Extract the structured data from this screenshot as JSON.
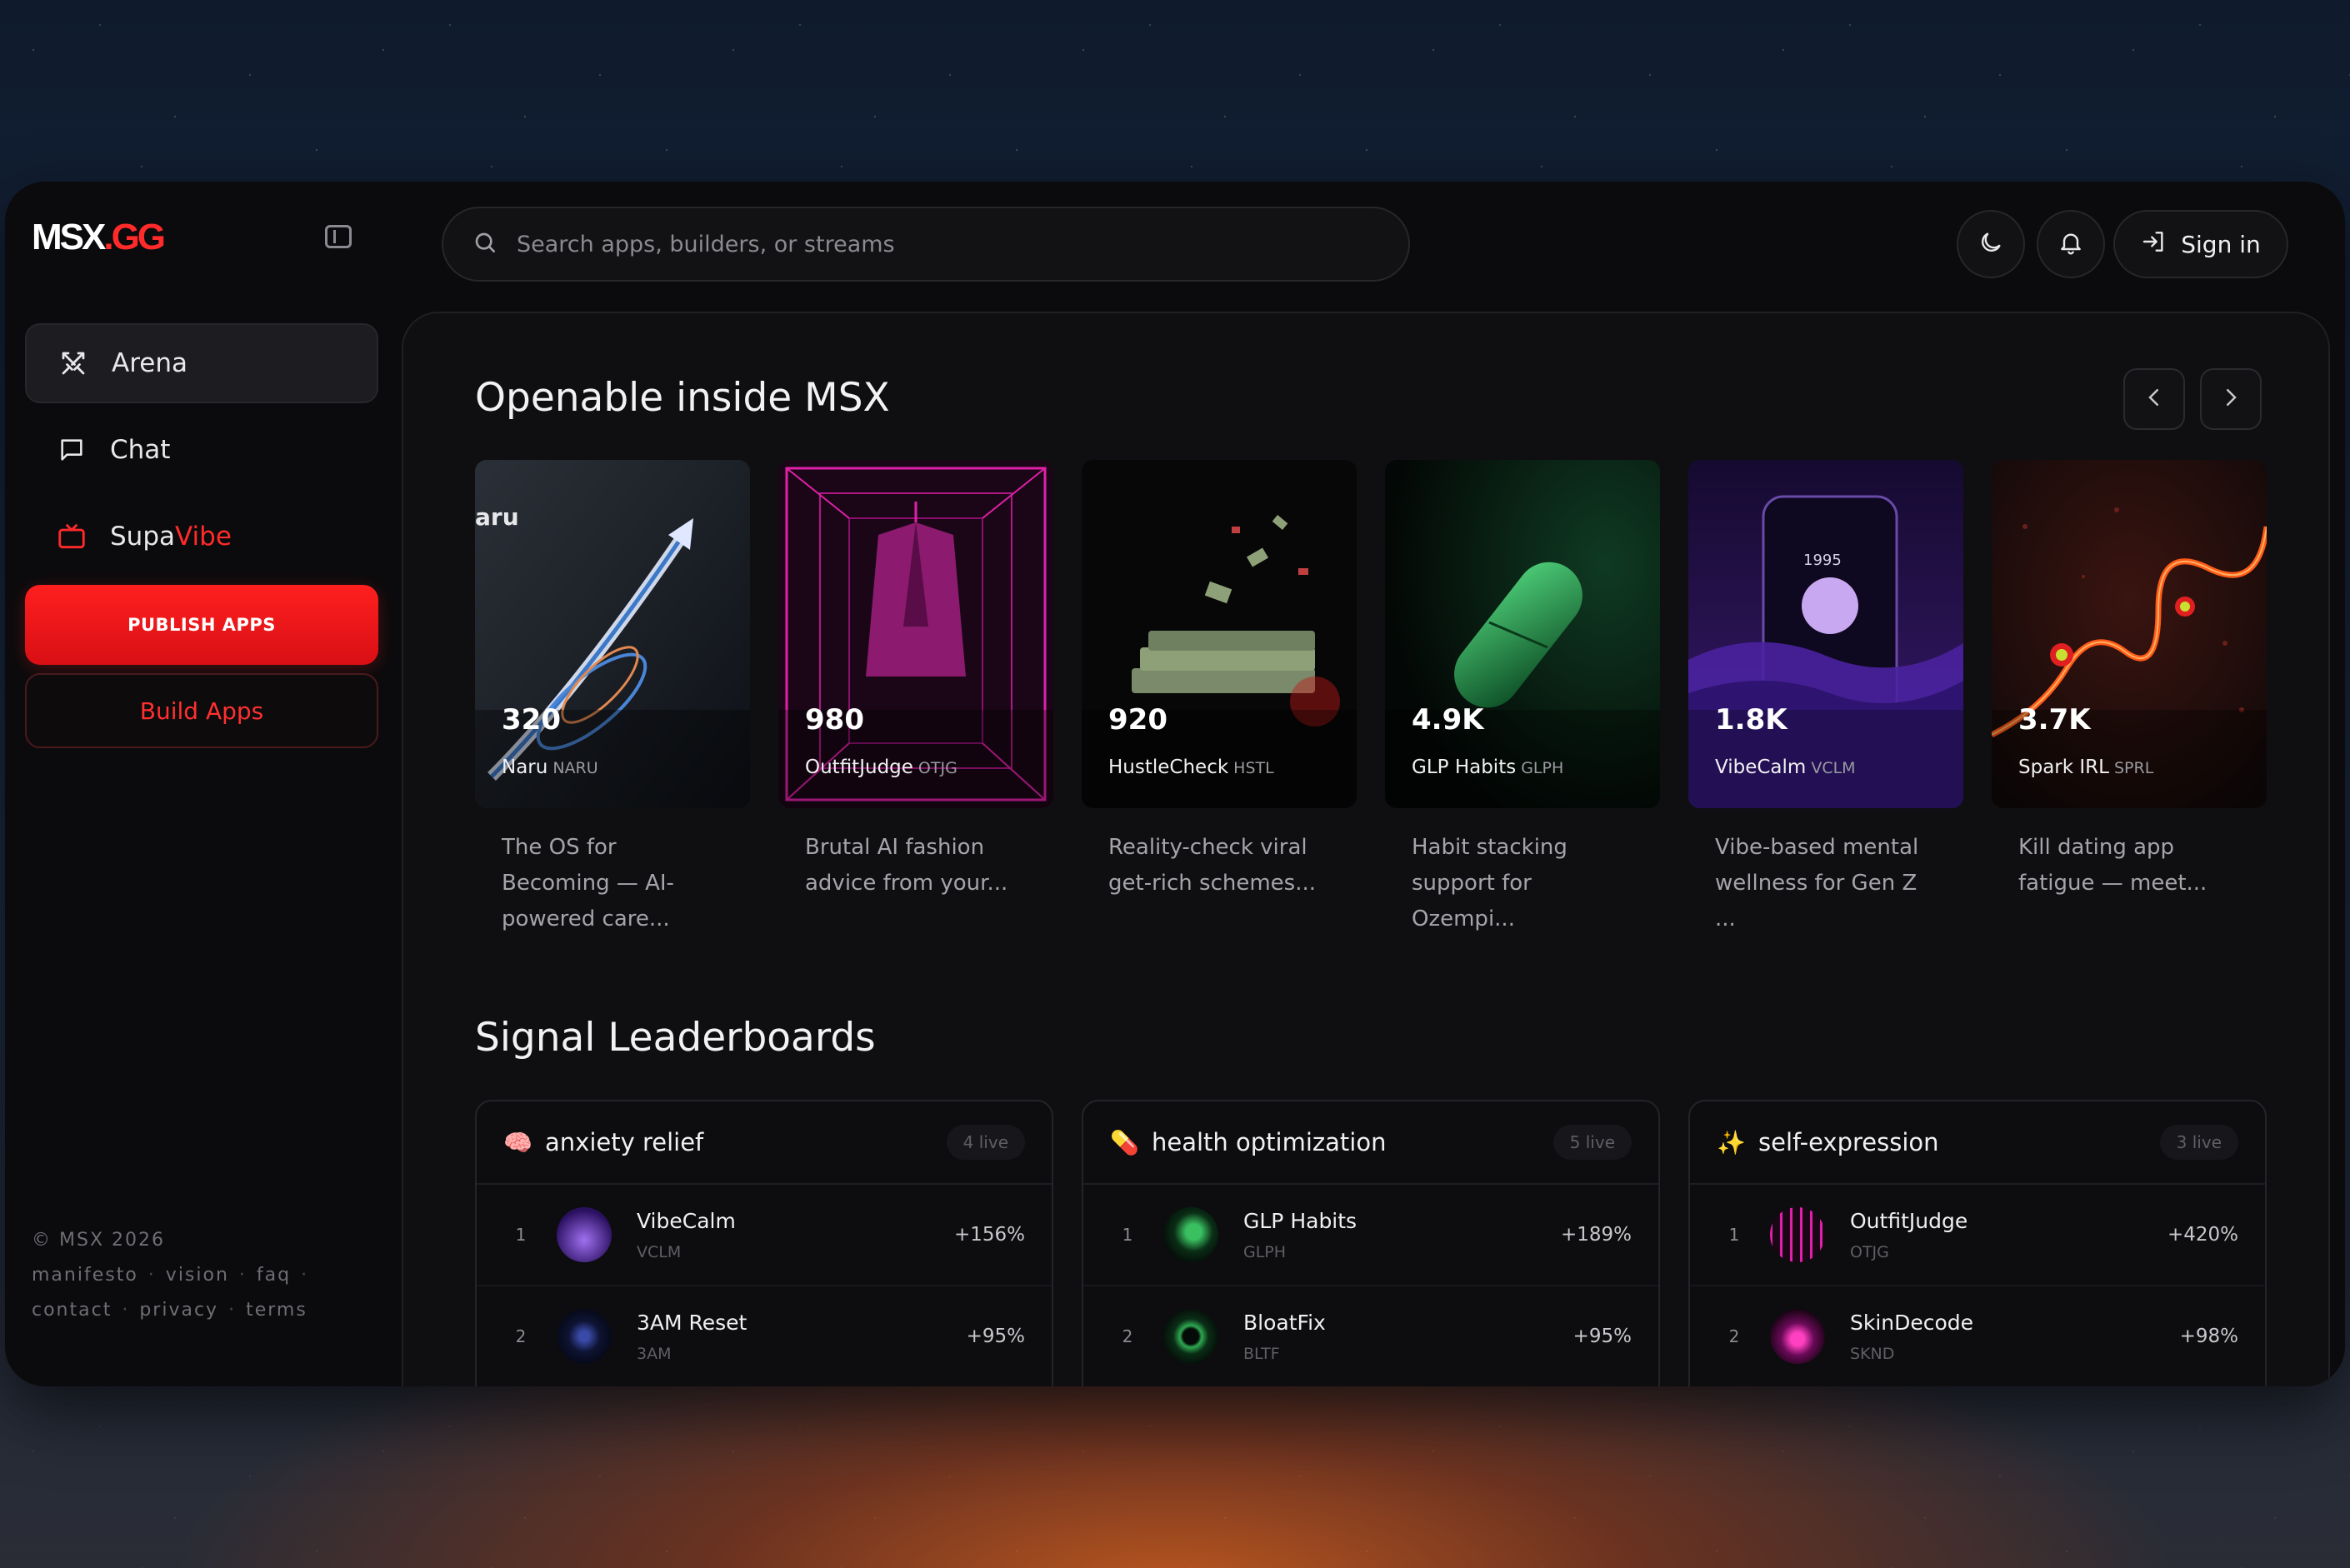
{
  "brand": {
    "logo_main": "MSX",
    "logo_dot": ".GG"
  },
  "sidebar": {
    "items": [
      {
        "label": "Arena",
        "icon": "crossed-swords-icon",
        "active": true
      },
      {
        "label": "Chat",
        "icon": "chat-bubble-icon"
      },
      {
        "label_a": "Supa",
        "label_b": "Vibe",
        "icon": "tv-icon"
      }
    ],
    "publish_label": "PUBLISH APPS",
    "build_label": "Build Apps",
    "footer": {
      "copyright": "© MSX 2026",
      "links": [
        "manifesto",
        "vision",
        "faq",
        "contact",
        "privacy",
        "terms"
      ]
    }
  },
  "header": {
    "search_placeholder": "Search apps, builders, or streams",
    "signin_label": "Sign in"
  },
  "openable": {
    "title": "Openable inside MSX",
    "cards": [
      {
        "count": "320",
        "name": "Naru",
        "ticker": "NARU",
        "desc": "The OS for Becoming — AI-powered care...",
        "brand_text": "aru"
      },
      {
        "count": "980",
        "name": "OutfitJudge",
        "ticker": "OTJG",
        "desc": "Brutal AI fashion advice from your..."
      },
      {
        "count": "920",
        "name": "HustleCheck",
        "ticker": "HSTL",
        "desc": "Reality-check viral get-rich schemes..."
      },
      {
        "count": "4.9K",
        "name": "GLP Habits",
        "ticker": "GLPH",
        "desc": "Habit stacking support for Ozempi..."
      },
      {
        "count": "1.8K",
        "name": "VibeCalm",
        "ticker": "VCLM",
        "desc": "Vibe-based mental wellness for Gen Z ...",
        "screen_text": "1995"
      },
      {
        "count": "3.7K",
        "name": "Spark IRL",
        "ticker": "SPRL",
        "desc": "Kill dating app fatigue — meet..."
      }
    ]
  },
  "leaderboards": {
    "title": "Signal Leaderboards",
    "boards": [
      {
        "emoji": "🧠",
        "title": "anxiety relief",
        "live": "4 live",
        "rows": [
          {
            "rank": "1",
            "name": "VibeCalm",
            "ticker": "VCLM",
            "delta": "+156%"
          },
          {
            "rank": "2",
            "name": "3AM Reset",
            "ticker": "3AM",
            "delta": "+95%"
          }
        ]
      },
      {
        "emoji": "💊",
        "title": "health optimization",
        "live": "5 live",
        "rows": [
          {
            "rank": "1",
            "name": "GLP Habits",
            "ticker": "GLPH",
            "delta": "+189%"
          },
          {
            "rank": "2",
            "name": "BloatFix",
            "ticker": "BLTF",
            "delta": "+95%"
          }
        ]
      },
      {
        "emoji": "✨",
        "title": "self-expression",
        "live": "3 live",
        "rows": [
          {
            "rank": "1",
            "name": "OutfitJudge",
            "ticker": "OTJG",
            "delta": "+420%"
          },
          {
            "rank": "2",
            "name": "SkinDecode",
            "ticker": "SKND",
            "delta": "+98%"
          }
        ]
      }
    ]
  },
  "colors": {
    "accent": "#ff2a2a",
    "panel": "#0f0f12",
    "window": "#0b0b0d"
  }
}
